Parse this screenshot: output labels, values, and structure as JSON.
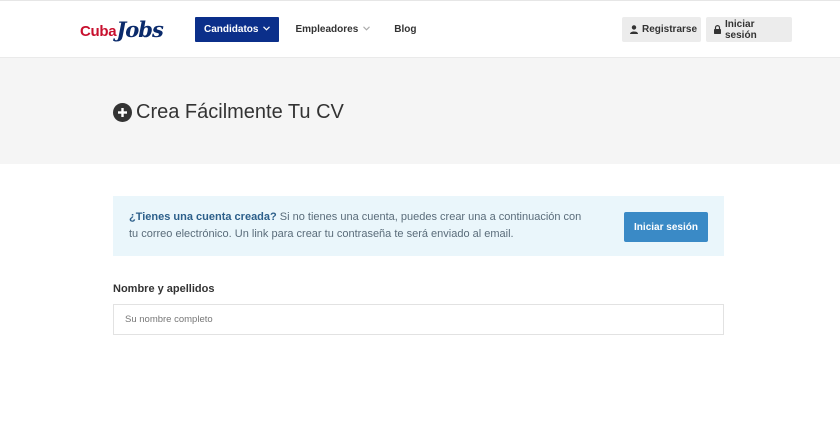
{
  "header": {
    "logo_part1": "Cuba",
    "logo_part2": "Jobs",
    "nav": {
      "candidatos": "Candidatos",
      "empleadores": "Empleadores",
      "blog": "Blog"
    },
    "register_label": "Registrarse",
    "login_label": "Iniciar sesión"
  },
  "hero": {
    "title": "Crea Fácilmente Tu CV"
  },
  "info": {
    "question": "¿Tienes una cuenta creada?",
    "message": " Si no tienes una cuenta, puedes crear una a continuación con tu correo electrónico. Un link para crear tu contraseña te será enviado al email.",
    "button_label": "Iniciar sesión"
  },
  "form": {
    "name_label": "Nombre y apellidos",
    "name_value": "",
    "name_placeholder": "Su nombre completo"
  },
  "colors": {
    "brand_navy": "#0b2f8a",
    "brand_red": "#c8102e",
    "info_button": "#3a8ac6",
    "info_bg": "#eaf6fb"
  }
}
